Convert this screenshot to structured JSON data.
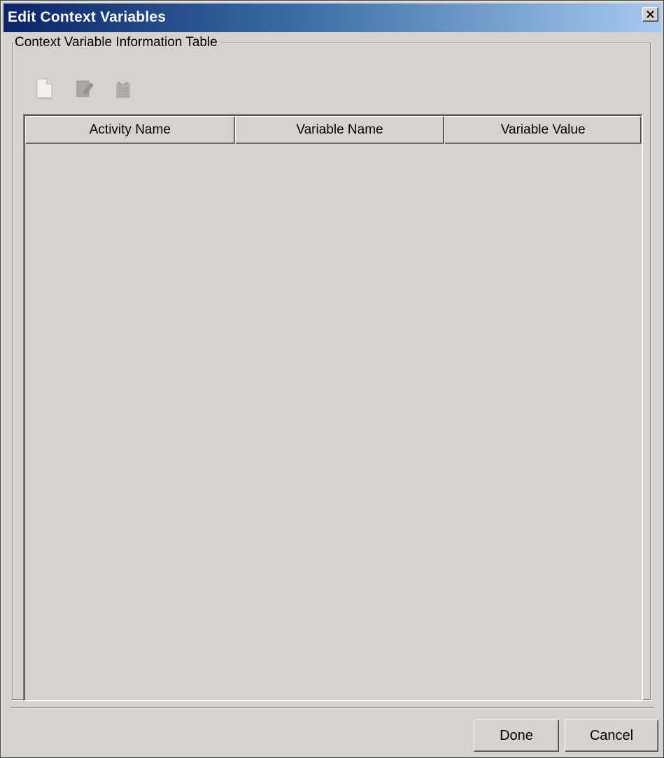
{
  "window": {
    "title": "Edit Context Variables"
  },
  "group": {
    "legend": "Context Variable Information Table"
  },
  "toolbar": {
    "icons": [
      "new-document-icon",
      "edit-icon",
      "delete-icon"
    ],
    "state": "disabled"
  },
  "table": {
    "columns": [
      {
        "label": "Activity Name"
      },
      {
        "label": "Variable Name"
      },
      {
        "label": "Variable Value"
      }
    ],
    "rows": []
  },
  "buttons": {
    "done_label": "Done",
    "cancel_label": "Cancel"
  },
  "colors": {
    "face": "#d6d3ce",
    "title_start": "#0a246a",
    "title_end": "#a6caf0",
    "title_text": "#ffffff"
  }
}
